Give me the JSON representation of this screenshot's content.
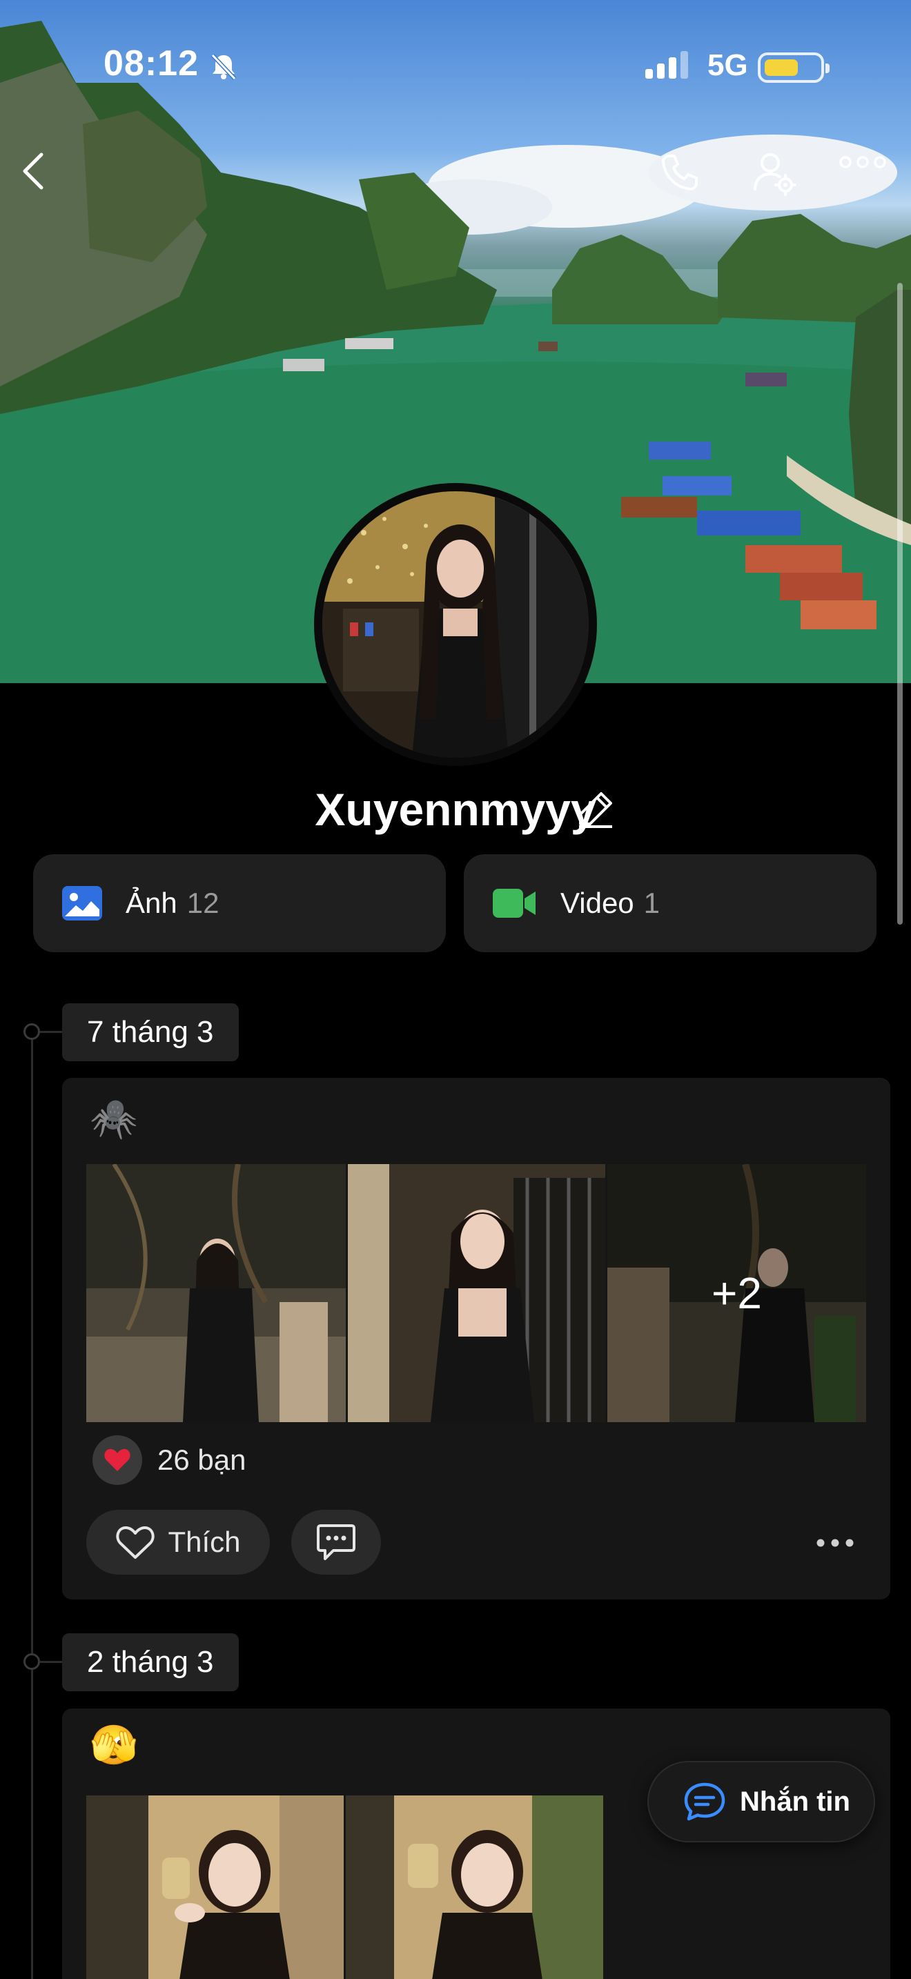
{
  "status_bar": {
    "time": "08:12",
    "network": "5G",
    "icons": [
      "bell-slash-icon",
      "cellular-signal-icon",
      "battery-icon"
    ],
    "battery_color": "#f5d33b"
  },
  "header": {
    "back_icon": "chevron-left-icon",
    "actions": [
      "phone-icon",
      "user-settings-icon",
      "more-horizontal-icon"
    ]
  },
  "profile": {
    "name": "Xuyennmyyy",
    "edit_icon": "pencil-icon"
  },
  "media": {
    "photos_label": "Ảnh",
    "photos_count": "12",
    "videos_label": "Video",
    "videos_count": "1",
    "photos_icon_color": "#2f6fe0",
    "videos_icon_color": "#3fba5a"
  },
  "timeline": [
    {
      "date": "7 tháng 3",
      "emoji": "🕷️",
      "extra_photos": "+2",
      "reactions": "26 bạn",
      "like_label": "Thích"
    },
    {
      "date": "2 tháng 3",
      "emoji": "🫣"
    }
  ],
  "fab": {
    "label": "Nhắn tin",
    "icon": "chat-bubble-icon",
    "accent": "#3a8dff"
  }
}
